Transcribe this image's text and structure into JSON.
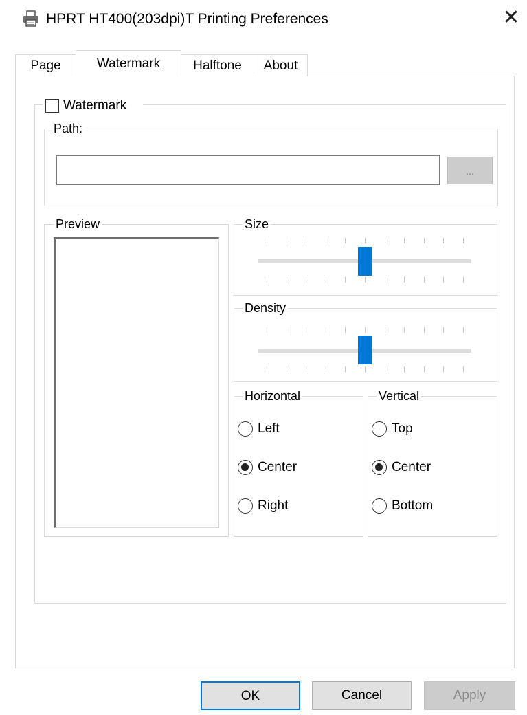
{
  "window": {
    "title": "HPRT HT400(203dpi)T Printing Preferences",
    "icon": "printer-icon",
    "close_glyph": "✕"
  },
  "tabs": [
    {
      "label": "Page",
      "active": false
    },
    {
      "label": "Watermark",
      "active": true
    },
    {
      "label": "Halftone",
      "active": false
    },
    {
      "label": "About",
      "active": false
    }
  ],
  "watermark": {
    "checkbox_label": "Watermark",
    "checked": false,
    "path_legend": "Path:",
    "path_value": "",
    "browse_label": "...",
    "preview_legend": "Preview",
    "size_legend": "Size",
    "size_level": 0.5,
    "density_legend": "Density",
    "density_level": 0.5,
    "horizontal_legend": "Horizontal",
    "horizontal_options": [
      "Left",
      "Center",
      "Right"
    ],
    "horizontal_selected": "Center",
    "vertical_legend": "Vertical",
    "vertical_options": [
      "Top",
      "Center",
      "Bottom"
    ],
    "vertical_selected": "Center"
  },
  "buttons": {
    "ok": "OK",
    "cancel": "Cancel",
    "apply": "Apply",
    "apply_enabled": false
  },
  "colors": {
    "accent": "#0078d7",
    "disabled_text": "#8a8a8a"
  }
}
